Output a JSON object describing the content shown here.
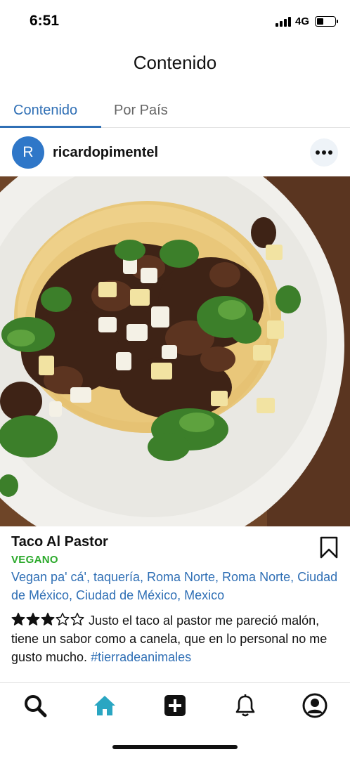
{
  "status_bar": {
    "time": "6:51",
    "network": "4G",
    "battery_level": 0.3
  },
  "header": {
    "title": "Contenido"
  },
  "tabs": [
    {
      "label": "Contenido",
      "active": true
    },
    {
      "label": "Por País",
      "active": false
    }
  ],
  "post": {
    "avatar_initial": "R",
    "username": "ricardopimentel",
    "title": "Taco Al Pastor",
    "tag": "VEGANO",
    "location": "Vegan pa' cá', taquería, Roma Norte, Roma Norte, Ciudad de México, Ciudad de México, Mexico",
    "rating": 3,
    "rating_max": 5,
    "review_text": "Justo el taco al pastor me pareció malón, tiene un sabor como a canela, que en lo personal no me gusto mucho. ",
    "hashtag": "#tierradeanimales"
  },
  "bottom_nav": [
    {
      "icon": "search-icon",
      "active": false
    },
    {
      "icon": "home-icon",
      "active": true
    },
    {
      "icon": "plus-square-icon",
      "active": false
    },
    {
      "icon": "bell-icon",
      "active": false
    },
    {
      "icon": "profile-icon",
      "active": false
    }
  ],
  "colors": {
    "accent": "#2f6fb5",
    "tag_green": "#2aa92a",
    "active_nav": "#2aa6c2",
    "avatar_bg": "#2f77c8"
  }
}
